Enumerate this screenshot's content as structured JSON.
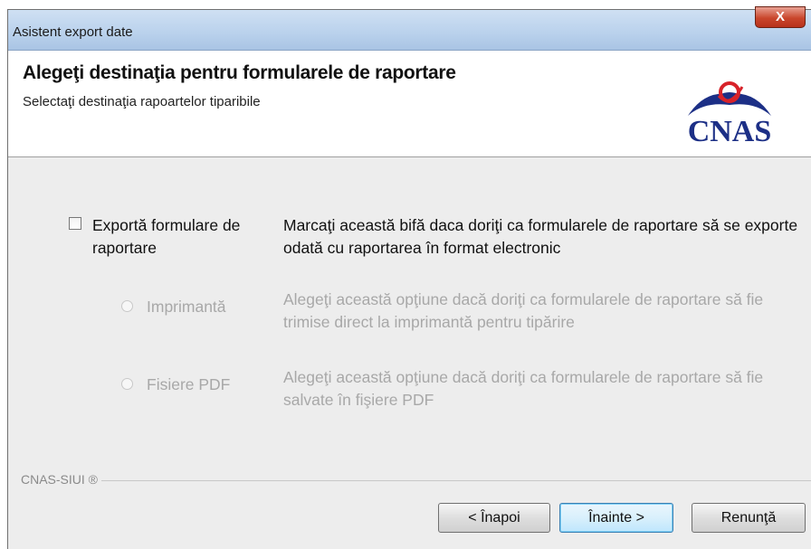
{
  "window": {
    "title": "Asistent export date",
    "close_label": "X"
  },
  "header": {
    "title": "Alegeţi destinaţia pentru formularele de raportare",
    "subtitle": "Selectaţi destinaţia rapoartelor tiparibile",
    "logo_text": "CNAS"
  },
  "options": {
    "export": {
      "label": "Exportă formulare de raportare",
      "description": "Marcaţi această bifă daca doriţi ca formularele de raportare să se exporte odată cu raportarea în format electronic",
      "checked": false
    },
    "printer": {
      "label": "Imprimantă",
      "description": "Alegeţi această opţiune dacă doriţi ca formularele de raportare să fie trimise direct la imprimantă pentru tipărire",
      "enabled": false
    },
    "pdf": {
      "label": "Fisiere PDF",
      "description": "Alegeţi această opţiune dacă doriţi ca formularele de raportare să fie salvate în fişiere PDF",
      "enabled": false
    }
  },
  "footer": {
    "brand": "CNAS-SIUI ®",
    "back_label": "< Înapoi",
    "next_label": "Înainte >",
    "cancel_label": "Renunţă"
  },
  "colors": {
    "logo_blue": "#1c2f86",
    "logo_red": "#d8232a",
    "disabled_text": "#a8a8a8"
  }
}
